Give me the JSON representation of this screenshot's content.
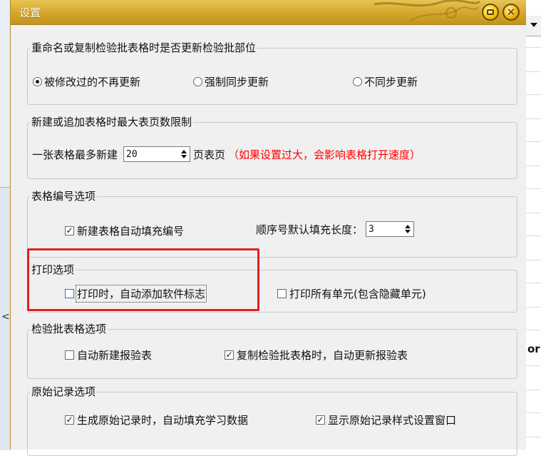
{
  "dialog": {
    "title": "设置"
  },
  "background": {
    "right_cut_text": "ori",
    "left_glyph": "<"
  },
  "groups": {
    "rename": {
      "title": "重命名或复制检验批表格时是否更新检验批部位",
      "options": [
        {
          "label": "被修改过的不再更新",
          "selected": true
        },
        {
          "label": "强制同步更新",
          "selected": false
        },
        {
          "label": "不同步更新",
          "selected": false
        }
      ]
    },
    "new_pages": {
      "title": "新建或追加表格时最大表页数限制",
      "prefix": "一张表格最多新建",
      "value": "20",
      "suffix": "页表页",
      "warning": "（如果设置过大，会影响表格打开速度）"
    },
    "numbering": {
      "title": "表格编号选项",
      "auto_fill_label": "新建表格自动填充编号",
      "auto_fill_checked": true,
      "seq_label": "顺序号默认填充长度：",
      "seq_value": "3"
    },
    "print": {
      "title": "打印选项",
      "auto_logo_label": "打印时，自动添加软件标志",
      "auto_logo_checked": false,
      "print_all_label": "打印所有单元(包含隐藏单元)",
      "print_all_checked": false
    },
    "inspection": {
      "title": "检验批表格选项",
      "auto_new_label": "自动新建报验表",
      "auto_new_checked": false,
      "copy_update_label": "复制检验批表格时，自动更新报验表",
      "copy_update_checked": true
    },
    "records": {
      "title": "原始记录选项",
      "gen_fill_label": "生成原始记录时，自动填充学习数据",
      "gen_fill_checked": true,
      "show_style_label": "显示原始记录样式设置窗口",
      "show_style_checked": true
    }
  },
  "colors": {
    "title_bar": "#d4a62a",
    "warning": "#ff0000",
    "highlight": "#e0211c"
  }
}
